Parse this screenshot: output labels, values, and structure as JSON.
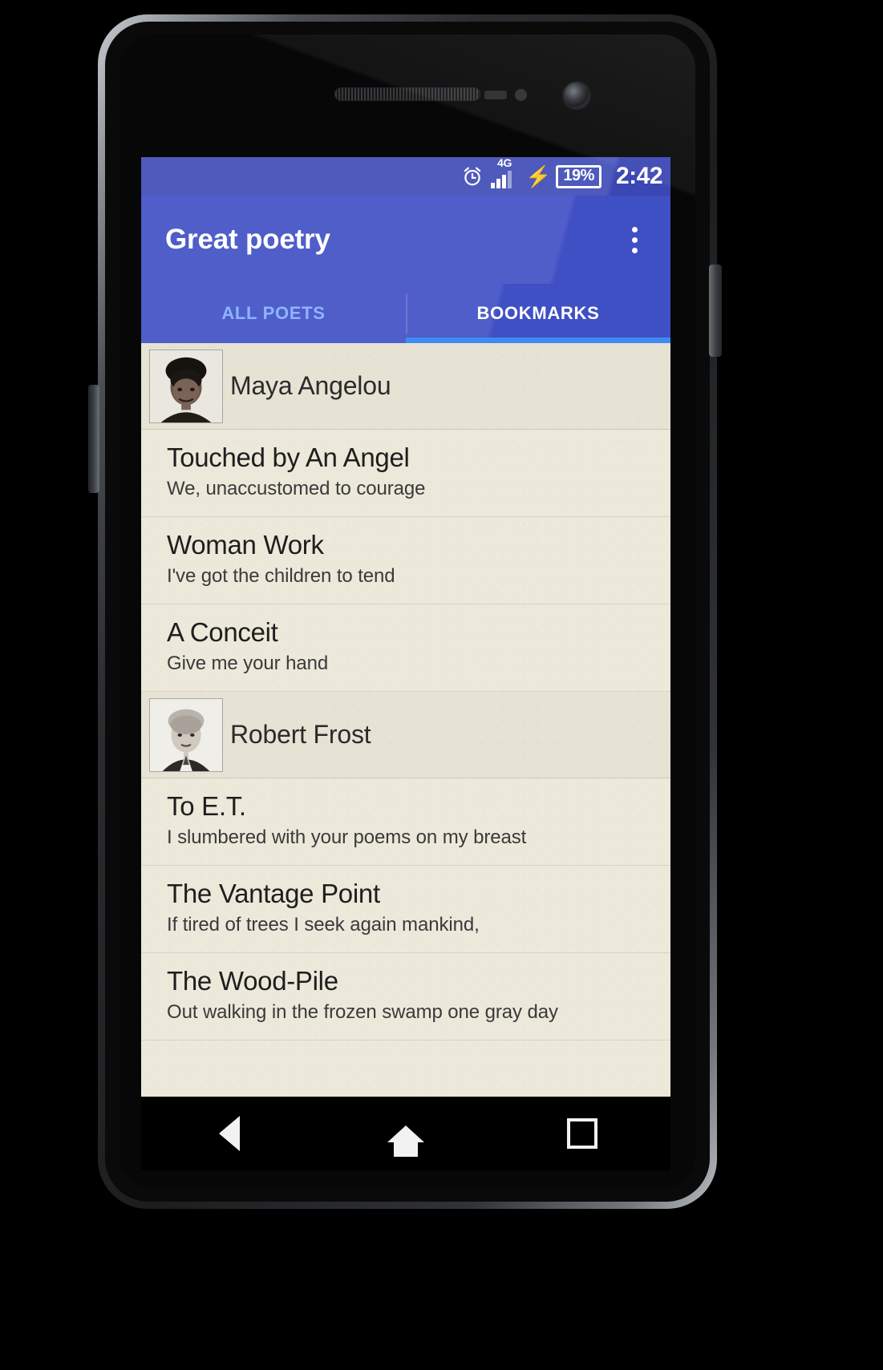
{
  "statusbar": {
    "alarm_icon": "alarm-clock-icon",
    "network_label": "4G",
    "charging_icon": "charging-bolt-icon",
    "battery_level": "19%",
    "time": "2:42"
  },
  "appbar": {
    "title": "Great poetry",
    "overflow_icon": "overflow-menu-icon"
  },
  "tabs": [
    {
      "label": "ALL POETS",
      "active": false
    },
    {
      "label": "BOOKMARKS",
      "active": true
    }
  ],
  "colors": {
    "status_bar": "#3a47b4",
    "app_bar": "#3f4fc4",
    "tab_indicator": "#3d8bf2",
    "tab_inactive_text": "#8fb4ff",
    "tab_active_text": "#ffffff",
    "list_background": "#ece8da"
  },
  "list": [
    {
      "kind": "poet",
      "name": "Maya Angelou",
      "avatar": "maya-angelou-portrait"
    },
    {
      "kind": "poem",
      "title": "Touched by An Angel",
      "first_line": "We, unaccustomed to courage"
    },
    {
      "kind": "poem",
      "title": "Woman Work",
      "first_line": "I've got the children to tend"
    },
    {
      "kind": "poem",
      "title": "A Conceit",
      "first_line": "Give me your hand"
    },
    {
      "kind": "poet",
      "name": "Robert Frost",
      "avatar": "robert-frost-portrait"
    },
    {
      "kind": "poem",
      "title": "To E.T.",
      "first_line": "I slumbered with your poems on my breast"
    },
    {
      "kind": "poem",
      "title": "The Vantage Point",
      "first_line": "If tired of trees I seek again mankind,"
    },
    {
      "kind": "poem",
      "title": "The Wood-Pile",
      "first_line": "Out walking in the frozen swamp one gray day"
    }
  ],
  "navbar": {
    "back_label": "Back",
    "home_label": "Home",
    "recents_label": "Recents"
  }
}
